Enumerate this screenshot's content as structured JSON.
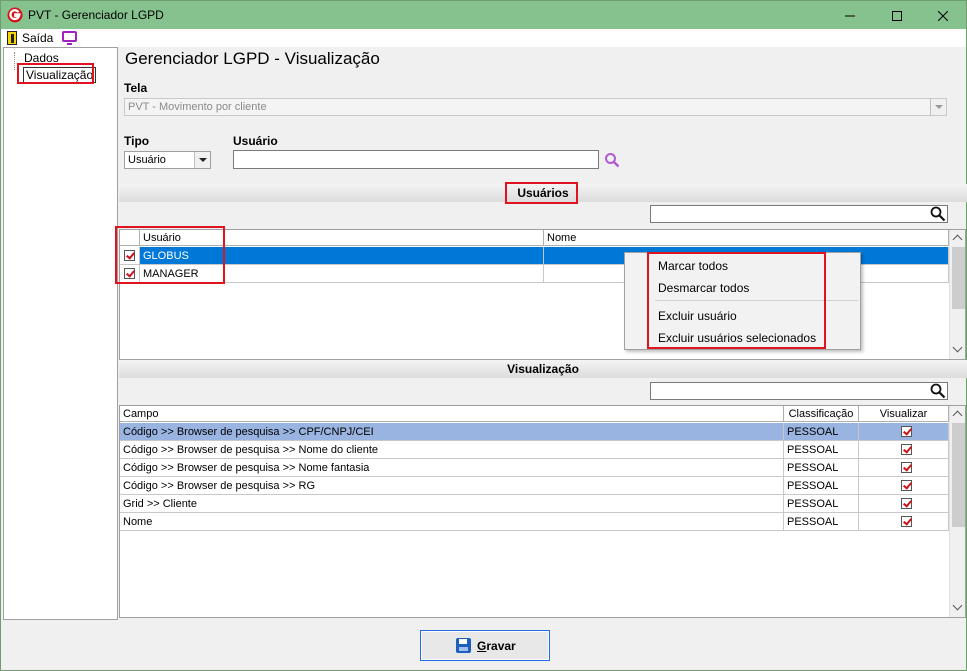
{
  "window": {
    "title": "PVT - Gerenciador LGPD",
    "controls": [
      "minimize",
      "maximize",
      "close"
    ]
  },
  "menu": {
    "exit_label": "Saída"
  },
  "sidebar": {
    "items": [
      {
        "label": "Dados"
      },
      {
        "label": "Visualização",
        "selected": true
      }
    ]
  },
  "page": {
    "title": "Gerenciador LGPD - Visualização"
  },
  "form": {
    "tela_label": "Tela",
    "tela_value": "PVT - Movimento por cliente",
    "tipo_label": "Tipo",
    "tipo_value": "Usuário",
    "usuario_label": "Usuário",
    "usuario_value": ""
  },
  "users_section": {
    "title": "Usuários",
    "search_value": "",
    "columns": [
      "Usuário",
      "Nome"
    ],
    "rows": [
      {
        "checked": true,
        "usuario": "GLOBUS",
        "nome": "",
        "selected": true
      },
      {
        "checked": true,
        "usuario": "MANAGER",
        "nome": ""
      }
    ]
  },
  "context_menu": {
    "items": [
      "Marcar todos",
      "Desmarcar todos",
      "Excluir usuário",
      "Excluir usuários selecionados"
    ]
  },
  "view_section": {
    "title": "Visualização",
    "search_value": "",
    "columns": [
      "Campo",
      "Classificação",
      "Visualizar"
    ],
    "rows": [
      {
        "campo": "Código >> Browser de pesquisa >> CPF/CNPJ/CEI",
        "classificacao": "PESSOAL",
        "visualizar": true,
        "selected": true
      },
      {
        "campo": "Código >> Browser de pesquisa >> Nome do cliente",
        "classificacao": "PESSOAL",
        "visualizar": true
      },
      {
        "campo": "Código >> Browser de pesquisa >> Nome fantasia",
        "classificacao": "PESSOAL",
        "visualizar": true
      },
      {
        "campo": "Código >> Browser de pesquisa >> RG",
        "classificacao": "PESSOAL",
        "visualizar": true
      },
      {
        "campo": "Grid >> Cliente",
        "classificacao": "PESSOAL",
        "visualizar": true
      },
      {
        "campo": "Nome",
        "classificacao": "PESSOAL",
        "visualizar": true
      }
    ]
  },
  "footer": {
    "save_label_underlined": "G",
    "save_label_rest": "ravar"
  },
  "colors": {
    "titlebar": "#86c28d",
    "selection": "#0078d7",
    "highlight": "#e0141e",
    "check": "#d0101a"
  }
}
